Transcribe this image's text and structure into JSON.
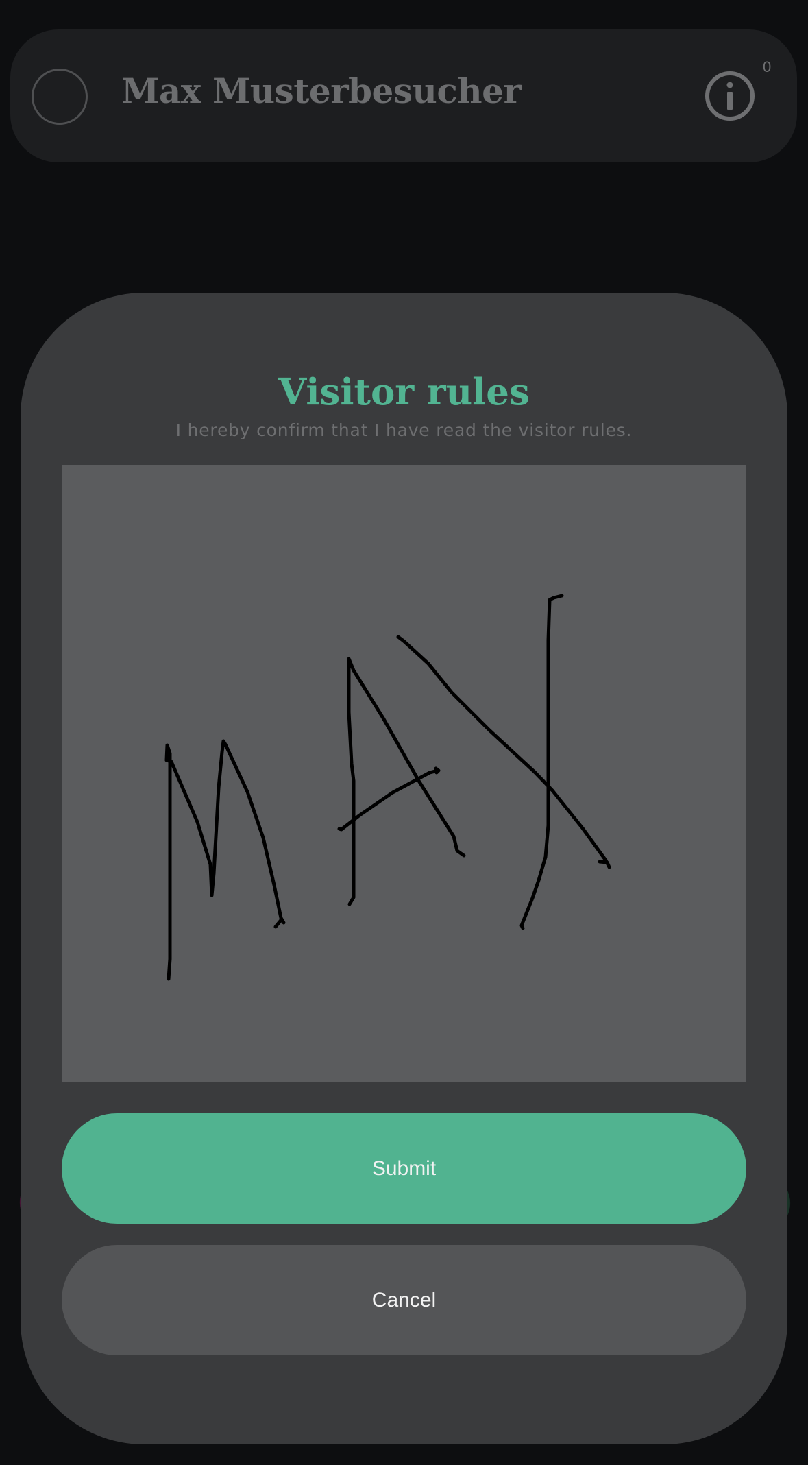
{
  "header": {
    "user_name": "Max Musterbesucher",
    "info_count": "0"
  },
  "modal": {
    "title": "Visitor rules",
    "subtitle": "I hereby confirm that I have read the visitor rules.",
    "signature_text": "MAX",
    "submit_label": "Submit",
    "cancel_label": "Cancel"
  },
  "colors": {
    "page_background": "#0d0e10",
    "header_background": "#1d1e20",
    "modal_background": "#3a3b3d",
    "accent": "#52b492",
    "signature_pad": "#5b5c5e",
    "cancel_button": "#545557"
  },
  "icons": {
    "avatar": "avatar-circle-icon",
    "info": "info-icon"
  }
}
